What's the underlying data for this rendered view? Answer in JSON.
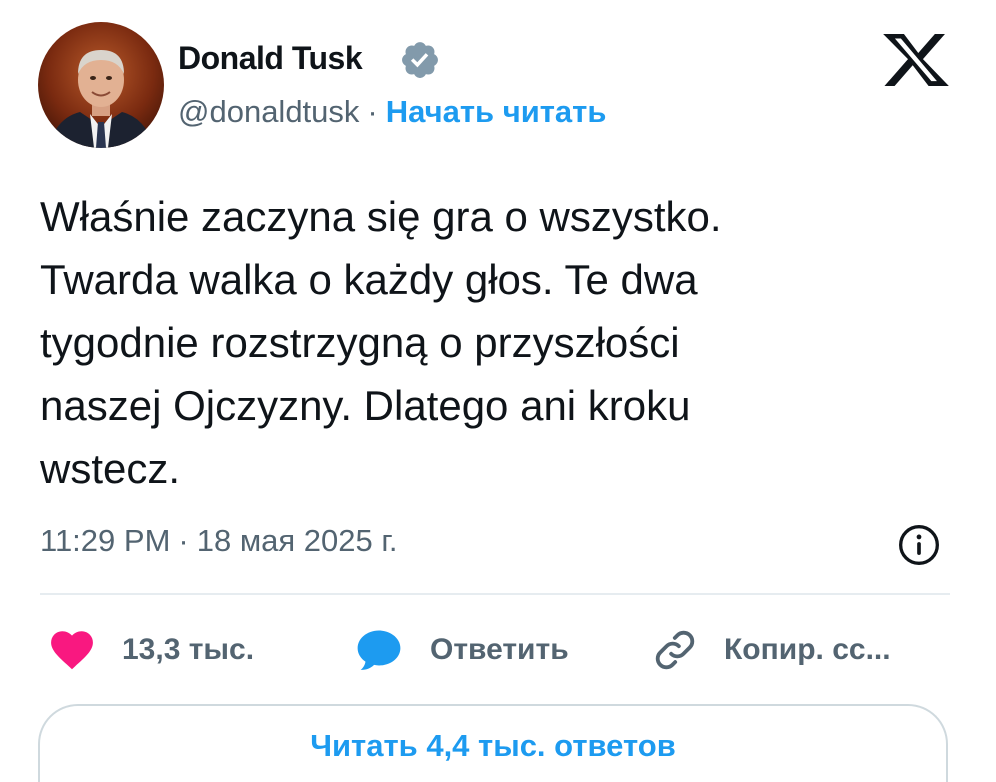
{
  "author": {
    "name": "Donald Tusk",
    "handle": "@donaldtusk",
    "separator": "·",
    "follow_label": "Начать читать",
    "verified_icon": "verified-badge-icon",
    "avatar_icon": "profile-photo"
  },
  "platform": {
    "logo_icon": "x-logo-icon"
  },
  "tweet": {
    "text": "Właśnie zaczyna się gra o wszystko.\nTwarda walka o każdy głos. Te dwa\ntygodnie rozstrzygną o przyszłości\nnaszej Ojczyzny. Dlatego ani kroku\nwstecz.",
    "time": "11:29 PM",
    "separator": "·",
    "date": "18 мая 2025 г."
  },
  "actions": {
    "like_count": "13,3 тыс.",
    "reply_label": "Ответить",
    "copy_label": "Копир. сс..."
  },
  "footer": {
    "read_replies_label": "Читать 4,4 тыс. ответов"
  },
  "colors": {
    "accent": "#1d9bf0",
    "like": "#f91880",
    "text": "#0f1419",
    "secondary": "#536471",
    "border": "#cfd9de"
  }
}
